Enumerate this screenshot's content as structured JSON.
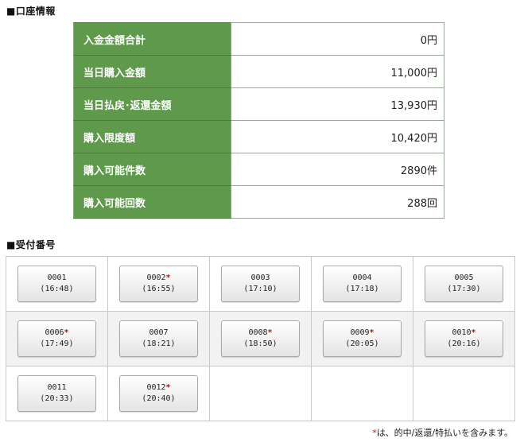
{
  "account": {
    "title": "■口座情報",
    "rows": [
      {
        "label": "入金金額合計",
        "value": "0円"
      },
      {
        "label": "当日購入金額",
        "value": "11,000円"
      },
      {
        "label": "当日払戻･返還金額",
        "value": "13,930円"
      },
      {
        "label": "購入限度額",
        "value": "10,420円"
      },
      {
        "label": "購入可能件数",
        "value": "2890件"
      },
      {
        "label": "購入可能回数",
        "value": "288回"
      }
    ]
  },
  "receipts": {
    "title": "■受付番号",
    "marker": "*",
    "items": [
      {
        "number": "0001",
        "time": "(16:48)",
        "mark": ""
      },
      {
        "number": "0002",
        "time": "(16:55)",
        "mark": "*"
      },
      {
        "number": "0003",
        "time": "(17:10)",
        "mark": ""
      },
      {
        "number": "0004",
        "time": "(17:18)",
        "mark": ""
      },
      {
        "number": "0005",
        "time": "(17:30)",
        "mark": ""
      },
      {
        "number": "0006",
        "time": "(17:49)",
        "mark": "*"
      },
      {
        "number": "0007",
        "time": "(18:21)",
        "mark": ""
      },
      {
        "number": "0008",
        "time": "(18:50)",
        "mark": "*"
      },
      {
        "number": "0009",
        "time": "(20:05)",
        "mark": "*"
      },
      {
        "number": "0010",
        "time": "(20:16)",
        "mark": "*"
      },
      {
        "number": "0011",
        "time": "(20:33)",
        "mark": ""
      },
      {
        "number": "0012",
        "time": "(20:40)",
        "mark": "*"
      }
    ]
  },
  "footnote": {
    "marker": "*",
    "text": "は、的中/返還/特払いを含みます。"
  }
}
